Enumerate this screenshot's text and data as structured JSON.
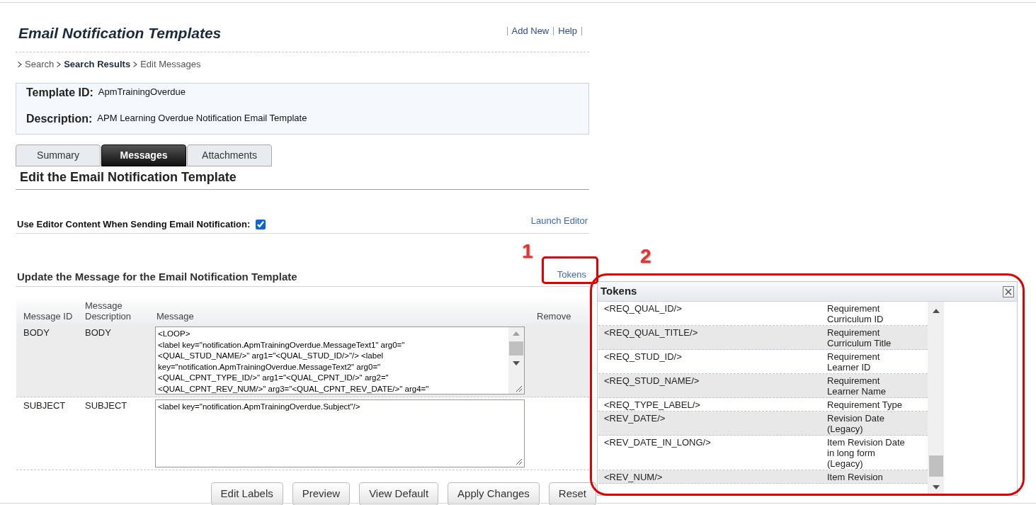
{
  "page_title": "Email Notification Templates",
  "header_links": [
    "Add New",
    "Help"
  ],
  "breadcrumb": [
    {
      "label": "Search",
      "current": false
    },
    {
      "label": "Search Results",
      "current": true
    },
    {
      "label": "Edit Messages",
      "current": false
    }
  ],
  "details": [
    {
      "label": "Template ID:",
      "value": "ApmTrainingOverdue"
    },
    {
      "label": "Description:",
      "value": "APM Learning Overdue Notification Email Template"
    }
  ],
  "tabs": [
    {
      "label": "Summary",
      "selected": false
    },
    {
      "label": "Messages",
      "selected": true
    },
    {
      "label": "Attachments",
      "selected": false
    }
  ],
  "section_title": "Edit the Email Notification Template",
  "use_editor": {
    "label": "Use Editor Content When Sending Email Notification:",
    "checked": true
  },
  "launch_editor": "Launch Editor",
  "message_section": {
    "title": "Update the Message for the Email Notification Template",
    "tokens_link": "Tokens"
  },
  "table": {
    "columns": [
      "Message ID",
      "Message Description",
      "Message",
      "Remove"
    ],
    "rows": [
      {
        "id": "BODY",
        "description": "BODY",
        "message_lines": [
          "<LOOP>",
          "<label key=\"notification.ApmTrainingOverdue.MessageText1\" arg0=\"",
          "<QUAL_STUD_NAME/>\" arg1=\"<QUAL_STUD_ID/>\"/> <label",
          "key=\"notification.ApmTrainingOverdue.MessageText2\" arg0=\"",
          "<QUAL_CPNT_TYPE_ID/>\" arg1=\"<QUAL_CPNT_ID/>\" arg2=\"",
          "<QUAL_CPNT_REV_NUM/>\" arg3=\"<QUAL_CPNT_REV_DATE/>\" arg4=\""
        ],
        "scrollable": true
      },
      {
        "id": "SUBJECT",
        "description": "SUBJECT",
        "message_lines": [
          "<label key=\"notification.ApmTrainingOverdue.Subject\"/>"
        ],
        "scrollable": false
      }
    ]
  },
  "buttons": [
    "Edit Labels",
    "Preview",
    "View Default",
    "Apply Changes",
    "Reset"
  ],
  "tokens_panel": {
    "title": "Tokens",
    "rows": [
      {
        "token": "<REQ_QUAL_ID/>",
        "description": "Requirement Curriculum ID"
      },
      {
        "token": "<REQ_QUAL_TITLE/>",
        "description": "Requirement Curriculum Title"
      },
      {
        "token": "<REQ_STUD_ID/>",
        "description": "Requirement Learner ID"
      },
      {
        "token": "<REQ_STUD_NAME/>",
        "description": "Requirement Learner Name"
      },
      {
        "token": "<REQ_TYPE_LABEL/>",
        "description": "Requirement Type"
      },
      {
        "token": "<REV_DATE/>",
        "description": "Revision Date (Legacy)"
      },
      {
        "token": "<REV_DATE_IN_LONG/>",
        "description": "Item Revision Date in long form (Legacy)"
      },
      {
        "token": "<REV_NUM/>",
        "description": "Item Revision"
      }
    ]
  },
  "annotations": [
    "1",
    "2"
  ]
}
